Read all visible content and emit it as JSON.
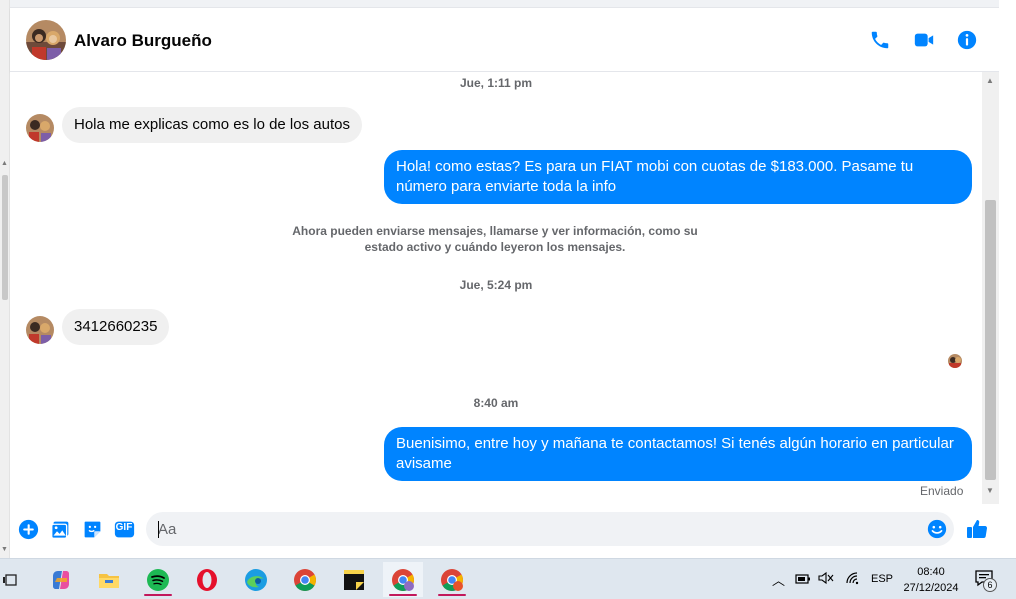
{
  "header": {
    "contact_name": "Alvaro Burgueño"
  },
  "messages": {
    "timestamp_1": "Jue, 1:11 pm",
    "incoming_1": "Hola me explicas como es lo de los autos",
    "outgoing_1": "Hola! como estas? Es para un FIAT mobi con cuotas de $183.000. Pasame tu número para enviarte toda la info",
    "system_note": "Ahora pueden enviarse mensajes, llamarse y ver información, como su estado activo y cuándo leyeron los mensajes.",
    "timestamp_2": "Jue, 5:24 pm",
    "incoming_2": "3412660235",
    "timestamp_3": "8:40 am",
    "outgoing_2": "Buenisimo, entre hoy y mañana te contactamos! Si tenés algún horario en particular avisame",
    "sent_status": "Enviado"
  },
  "composer": {
    "placeholder": "Aa",
    "gif_label": "GIF"
  },
  "taskbar": {
    "language": "ESP",
    "time": "08:40",
    "date": "27/12/2024",
    "notification_count": "6"
  },
  "colors": {
    "accent": "#0084ff",
    "incoming_bubble": "#f0f0f0",
    "secondary_text": "#65676b"
  }
}
